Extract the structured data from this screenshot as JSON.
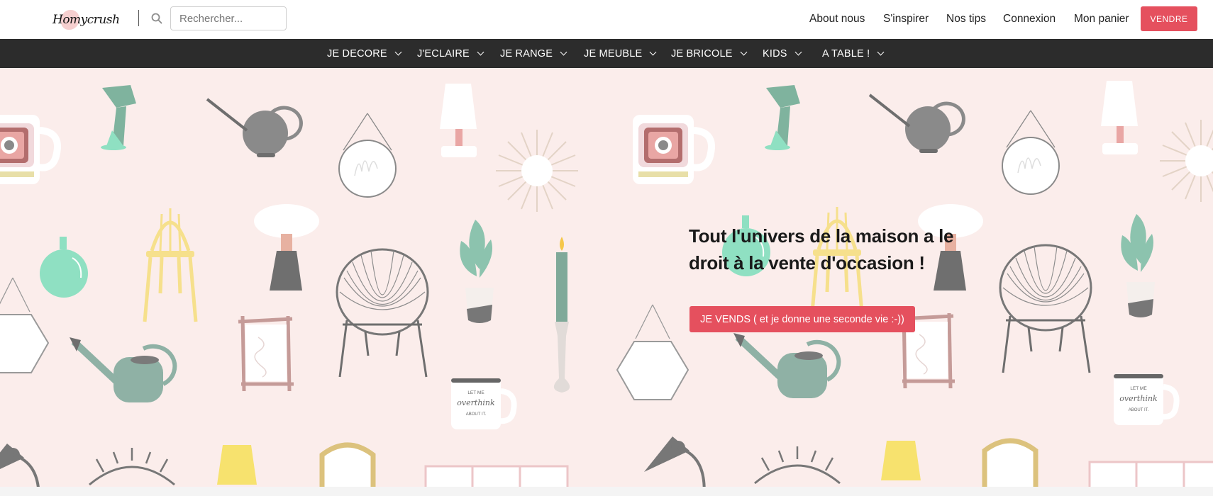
{
  "header": {
    "logo_text": "Homycrush",
    "search_placeholder": "Rechercher...",
    "search_icon": "search-icon",
    "nav": {
      "about": "About nous",
      "inspire": "S'inspirer",
      "tips": "Nos tips",
      "login": "Connexion",
      "cart": "Mon panier"
    },
    "sell_button": "VENDRE"
  },
  "categories": {
    "decore": "JE DECORE",
    "eclaire": "J'ECLAIRE",
    "range": "JE RANGE",
    "meuble": "JE MEUBLE",
    "bricole": "JE BRICOLE",
    "kids": "KIDS",
    "table": "A TABLE !"
  },
  "hero": {
    "title": "Tout l'univers de la maison a le droit à la vente d'occasion !",
    "cta": "JE VENDS ( et je donne une seconde vie :-))",
    "mug_text": "LET ME overthink ABOUT IT."
  },
  "colors": {
    "accent": "#e5505e",
    "category_bar": "#2c2c2c",
    "hero_bg": "#fbedeb"
  }
}
